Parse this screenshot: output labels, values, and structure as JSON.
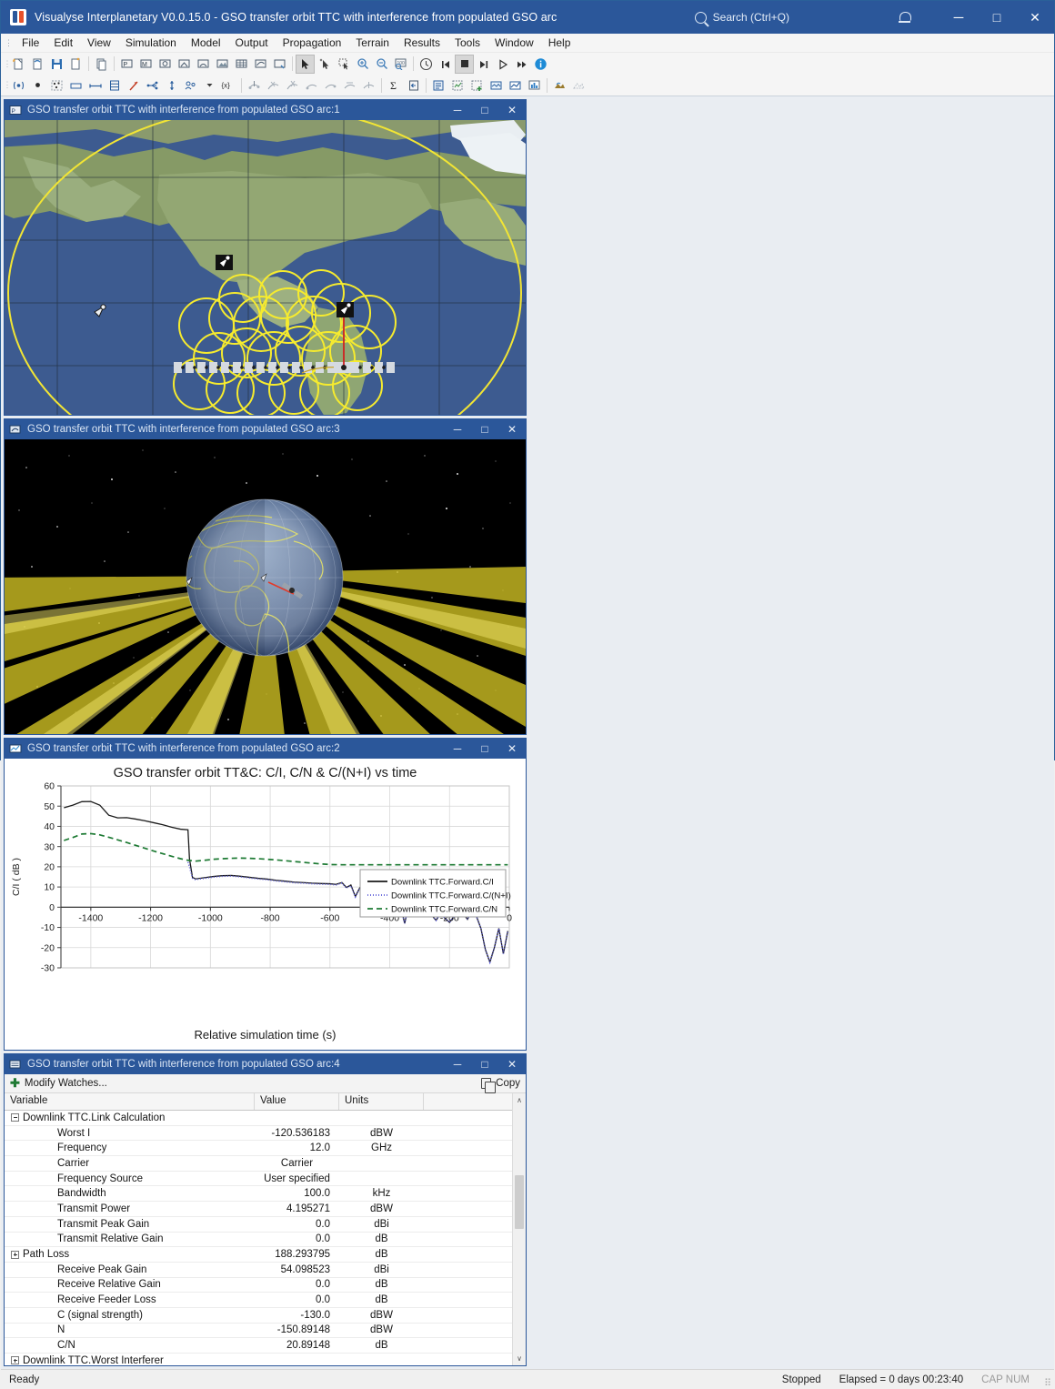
{
  "window": {
    "title": "Visualyse Interplanetary V0.0.15.0 - GSO transfer orbit TTC with interference from populated GSO arc",
    "logo_name": "visualyse-logo",
    "search_placeholder": "Search (Ctrl+Q)",
    "notification_icon": "bell-icon",
    "minimize_label": "─",
    "maximize_label": "□",
    "close_label": "✕"
  },
  "menu": {
    "items": [
      "File",
      "Edit",
      "View",
      "Simulation",
      "Model",
      "Output",
      "Propagation",
      "Terrain",
      "Results",
      "Tools",
      "Window",
      "Help"
    ]
  },
  "toolbar_row1": {
    "icons": [
      "new-document-icon",
      "open-document-icon",
      "save-icon",
      "save-as-icon",
      "copy-document-icon",
      "new-station-icon",
      "new-mobile-icon",
      "new-satellite-icon",
      "new-constellation-icon",
      "new-antenna-icon",
      "new-terrain-icon",
      "new-grid-icon",
      "new-link-icon",
      "new-view-icon",
      "pointer-select-icon",
      "pointer-add-icon",
      "rubber-band-select-icon",
      "zoom-in-icon",
      "zoom-out-icon",
      "zoom-region-icon",
      "clock-icon",
      "skip-start-icon",
      "stop-icon",
      "step-icon",
      "play-icon",
      "fast-forward-icon",
      "info-icon"
    ]
  },
  "toolbar_row2": {
    "icons": [
      "transmit-icon",
      "point-icon",
      "scatter-icon",
      "rectangle-icon",
      "line-icon",
      "table-icon",
      "vector-icon",
      "network-icon",
      "updown-icon",
      "group-icon",
      "dropdown-arrow-icon",
      "variable-icon",
      "link-budget-icon",
      "interference-path1-icon",
      "interference-path2-icon",
      "link-group1-icon",
      "link-group2-icon",
      "link-group3-icon",
      "link-group4-icon",
      "sigma-icon",
      "export-icon",
      "watch-window-icon",
      "settings-chart-icon",
      "add-chart-icon",
      "area-chart-icon",
      "line-chart-icon",
      "bar-chart-icon",
      "terrain-layer-icon",
      "terrain-add-icon"
    ]
  },
  "panes": {
    "map": {
      "title": "GSO transfer orbit TTC with interference from populated GSO arc:1",
      "icon": "map-view-icon",
      "minimize": "─",
      "maximize": "□",
      "close": "✕"
    },
    "space": {
      "title": "GSO transfer orbit TTC with interference from populated GSO arc:3",
      "icon": "3d-view-icon",
      "minimize": "─",
      "maximize": "□",
      "close": "✕"
    },
    "chart": {
      "title": "GSO transfer orbit TTC with interference from populated GSO arc:2",
      "icon": "chart-view-icon",
      "minimize": "─",
      "maximize": "□",
      "close": "✕"
    },
    "watch": {
      "title": "GSO transfer orbit TTC with interference from populated GSO arc:4",
      "icon": "watch-view-icon",
      "minimize": "─",
      "maximize": "□",
      "close": "✕",
      "modify_watches_label": "Modify Watches...",
      "copy_label": "Copy",
      "columns": [
        "Variable",
        "Value",
        "Units",
        ""
      ],
      "rows": [
        {
          "variable": "Downlink TTC.Link Calculation",
          "value": "",
          "units": "",
          "indent": 0,
          "expander": "minus"
        },
        {
          "variable": "Worst I",
          "value": "-120.536183",
          "units": "dBW",
          "indent": 1,
          "expander": "none"
        },
        {
          "variable": "Frequency",
          "value": "12.0",
          "units": "GHz",
          "indent": 1,
          "expander": "none"
        },
        {
          "variable": "Carrier",
          "value": "Carrier",
          "units": "",
          "indent": 1,
          "expander": "none"
        },
        {
          "variable": "Frequency Source",
          "value": "User specified",
          "units": "",
          "indent": 1,
          "expander": "none"
        },
        {
          "variable": "Bandwidth",
          "value": "100.0",
          "units": "kHz",
          "indent": 1,
          "expander": "none"
        },
        {
          "variable": "Transmit Power",
          "value": "4.195271",
          "units": "dBW",
          "indent": 1,
          "expander": "none"
        },
        {
          "variable": "Transmit Peak Gain",
          "value": "0.0",
          "units": "dBi",
          "indent": 1,
          "expander": "none"
        },
        {
          "variable": "Transmit Relative Gain",
          "value": "0.0",
          "units": "dB",
          "indent": 1,
          "expander": "none"
        },
        {
          "variable": "Path Loss",
          "value": "188.293795",
          "units": "dB",
          "indent": 0,
          "expander": "plus"
        },
        {
          "variable": "Receive Peak Gain",
          "value": "54.098523",
          "units": "dBi",
          "indent": 1,
          "expander": "none"
        },
        {
          "variable": "Receive Relative Gain",
          "value": "0.0",
          "units": "dB",
          "indent": 1,
          "expander": "none"
        },
        {
          "variable": "Receive Feeder Loss",
          "value": "0.0",
          "units": "dB",
          "indent": 1,
          "expander": "none"
        },
        {
          "variable": "C (signal strength)",
          "value": "-130.0",
          "units": "dBW",
          "indent": 1,
          "expander": "none"
        },
        {
          "variable": "N",
          "value": "-150.89148",
          "units": "dBW",
          "indent": 1,
          "expander": "none"
        },
        {
          "variable": "C/N",
          "value": "20.89148",
          "units": "dB",
          "indent": 1,
          "expander": "none"
        },
        {
          "variable": "Downlink TTC.Worst Interferer",
          "value": "",
          "units": "",
          "indent": 0,
          "expander": "plus"
        }
      ],
      "scroll_up": "∧",
      "scroll_down": "∨"
    }
  },
  "chart_data": {
    "type": "line",
    "title": "GSO transfer orbit TT&C: C/I, C/N & C/(N+I) vs time",
    "xlabel": "Relative simulation time (s)",
    "ylabel": "C/I ( dB )",
    "xlim": [
      -1500,
      0
    ],
    "ylim": [
      -30,
      60
    ],
    "xticks": [
      -1400,
      -1200,
      -1000,
      -800,
      -600,
      -400,
      -200,
      0
    ],
    "yticks": [
      60,
      50,
      40,
      30,
      20,
      10,
      0,
      -10,
      -20,
      -30
    ],
    "grid": true,
    "legend_position": "right",
    "series": [
      {
        "name": "Downlink TTC.Forward.C/I",
        "color": "#1a1a1a",
        "style": "solid",
        "x": [
          -1490,
          -1460,
          -1430,
          -1400,
          -1370,
          -1340,
          -1310,
          -1280,
          -1250,
          -1220,
          -1190,
          -1160,
          -1130,
          -1100,
          -1075,
          -1070,
          -1060,
          -1050,
          -1020,
          -990,
          -960,
          -930,
          -900,
          -870,
          -840,
          -810,
          -780,
          -750,
          -720,
          -690,
          -660,
          -630,
          -600,
          -580,
          -560,
          -545,
          -530,
          -515,
          -500,
          -485,
          -470,
          -455,
          -440,
          -425,
          -410,
          -395,
          -380,
          -365,
          -350,
          -335,
          -320,
          -305,
          -290,
          -275,
          -260,
          -245,
          -230,
          -215,
          -200,
          -185,
          -170,
          -155,
          -140,
          -125,
          -110,
          -95,
          -80,
          -65,
          -50,
          -35,
          -20,
          -5
        ],
        "y": [
          49.2,
          50.5,
          52.2,
          52.3,
          50.5,
          45.5,
          44.2,
          44.3,
          43.6,
          42.8,
          41.8,
          40.8,
          39.6,
          38.6,
          38.3,
          24.0,
          14.8,
          14.0,
          14.6,
          15.2,
          15.6,
          15.7,
          15.3,
          14.8,
          14.3,
          13.9,
          13.3,
          12.9,
          12.4,
          12.2,
          11.9,
          11.7,
          11.6,
          11.3,
          12.2,
          9.8,
          11.0,
          5.3,
          9.7,
          10.5,
          7.9,
          3.0,
          8.0,
          8.9,
          6.0,
          1.4,
          9.4,
          1.0,
          -8.0,
          2.3,
          6.7,
          3.5,
          0.5,
          -2.0,
          -4.0,
          -6.5,
          -3.0,
          -5.5,
          -7.5,
          -4.5,
          -2.3,
          -3.0,
          -6.0,
          -1.8,
          -4.5,
          -10.5,
          -21.0,
          -27.2,
          -20.0,
          -10.5,
          -23.0,
          -11.8
        ]
      },
      {
        "name": "Downlink TTC.Forward.C/(N+I)",
        "color": "#5a5ad8",
        "style": "dotted",
        "x": [
          -1075,
          -1070,
          -1060,
          -1050,
          -1020,
          -990,
          -960,
          -930,
          -900,
          -870,
          -840,
          -810,
          -780,
          -750,
          -720,
          -690,
          -660,
          -630,
          -600,
          -580,
          -560,
          -545,
          -530,
          -515,
          -500,
          -485,
          -470,
          -455,
          -440,
          -425,
          -410,
          -395,
          -380,
          -365,
          -350,
          -335,
          -320,
          -305,
          -290,
          -275,
          -260,
          -245,
          -230,
          -215,
          -200,
          -185,
          -170,
          -155,
          -140,
          -125,
          -110,
          -95,
          -80,
          -65,
          -50,
          -35,
          -20,
          -5
        ],
        "y": [
          22.3,
          20.0,
          14.4,
          13.7,
          14.3,
          14.9,
          15.3,
          15.4,
          15.0,
          14.5,
          14.0,
          13.6,
          13.0,
          12.6,
          12.1,
          11.9,
          11.6,
          11.4,
          11.3,
          11.0,
          11.9,
          9.5,
          10.7,
          5.1,
          9.4,
          10.2,
          7.7,
          2.9,
          7.8,
          8.7,
          5.8,
          1.3,
          9.1,
          0.9,
          -8.0,
          2.2,
          6.5,
          3.4,
          0.4,
          -2.0,
          -4.0,
          -6.5,
          -3.0,
          -5.5,
          -7.5,
          -4.5,
          -2.3,
          -3.0,
          -6.0,
          -1.8,
          -4.5,
          -10.5,
          -21.0,
          -27.2,
          -20.0,
          -10.5,
          -23.0,
          -11.8
        ]
      },
      {
        "name": "Downlink TTC.Forward.C/N",
        "color": "#1d7a33",
        "style": "dashed",
        "x": [
          -1490,
          -1460,
          -1430,
          -1400,
          -1370,
          -1340,
          -1310,
          -1280,
          -1250,
          -1220,
          -1190,
          -1160,
          -1130,
          -1100,
          -1075,
          -1050,
          -1020,
          -990,
          -960,
          -930,
          -900,
          -870,
          -840,
          -810,
          -780,
          -750,
          -720,
          -690,
          -660,
          -630,
          -600,
          -560,
          -520,
          -480,
          -440,
          -400,
          -350,
          -300,
          -250,
          -200,
          -150,
          -100,
          -50,
          -5
        ],
        "y": [
          33.0,
          34.5,
          36.2,
          36.4,
          35.8,
          34.6,
          33.3,
          32.0,
          30.6,
          29.2,
          27.8,
          26.5,
          25.2,
          24.0,
          23.2,
          22.8,
          23.2,
          23.7,
          24.0,
          24.2,
          24.3,
          24.2,
          24.0,
          23.7,
          23.4,
          23.0,
          22.6,
          22.2,
          21.8,
          21.4,
          21.1,
          21.0,
          21.0,
          21.0,
          21.0,
          21.0,
          21.0,
          21.0,
          21.0,
          21.0,
          21.0,
          21.0,
          21.0,
          21.0
        ]
      }
    ]
  },
  "statusbar": {
    "ready": "Ready",
    "sim_state": "Stopped",
    "elapsed": "Elapsed = 0 days 00:23:40",
    "keys": "CAP NUM"
  }
}
